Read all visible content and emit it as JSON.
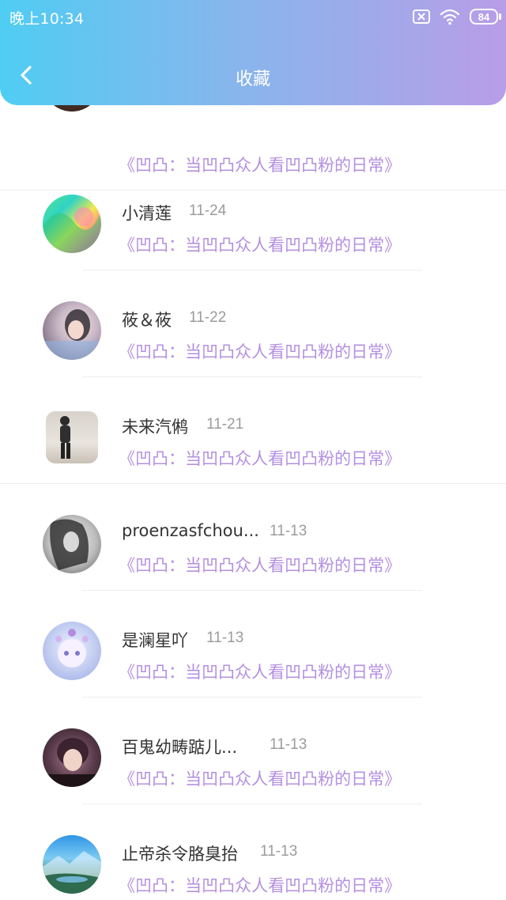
{
  "status_bar": {
    "time": "晚上10:34",
    "battery": "84"
  },
  "header": {
    "title": "收藏"
  },
  "list": [
    {
      "nickname": "",
      "date": "",
      "topic": "《凹凸：当凹凸众人看凹凸粉的日常》"
    },
    {
      "nickname": "小清莲",
      "date": "11-24",
      "topic": "《凹凸：当凹凸众人看凹凸粉的日常》"
    },
    {
      "nickname": "莜＆莜",
      "date": "11-22",
      "topic": "《凹凸：当凹凸众人看凹凸粉的日常》"
    },
    {
      "nickname": "未来汽鸺",
      "date": "11-21",
      "topic": "《凹凸：当凹凸众人看凹凸粉的日常》"
    },
    {
      "nickname": "proenzasfchou...",
      "date": "11-13",
      "topic": "《凹凸：当凹凸众人看凹凸粉的日常》"
    },
    {
      "nickname": "是澜星吖",
      "date": "11-13",
      "topic": "《凹凸：当凹凸众人看凹凸粉的日常》"
    },
    {
      "nickname": "百鬼幼畴踮儿...",
      "date": "11-13",
      "topic": "《凹凸：当凹凸众人看凹凸粉的日常》"
    },
    {
      "nickname": "止帝杀令胳臭抬",
      "date": "11-13",
      "topic": "《凹凸：当凹凸众人看凹凸粉的日常》"
    }
  ],
  "colors": {
    "header_gradient_start": "#4fcdf3",
    "header_gradient_end": "#b89de8",
    "topic_text": "#b48fe0",
    "date_text": "#9b9b9b",
    "nickname_text": "#333333"
  }
}
